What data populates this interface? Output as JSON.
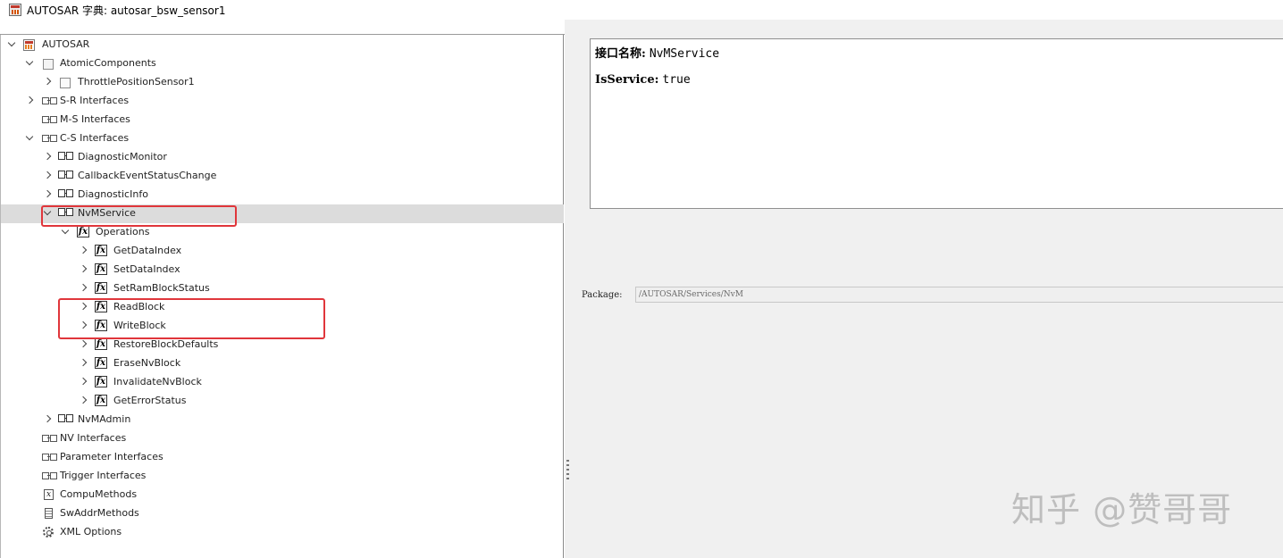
{
  "window": {
    "title": "AUTOSAR 字典: autosar_bsw_sensor1"
  },
  "tree": {
    "root": "AUTOSAR",
    "atomic_components": "AtomicComponents",
    "throttle_sensor": "ThrottlePositionSensor1",
    "sr_interfaces": "S-R Interfaces",
    "ms_interfaces": "M-S Interfaces",
    "cs_interfaces": "C-S Interfaces",
    "cs_items": [
      "DiagnosticMonitor",
      "CallbackEventStatusChange",
      "DiagnosticInfo",
      "NvMService"
    ],
    "operations_label": "Operations",
    "operations": [
      "GetDataIndex",
      "SetDataIndex",
      "SetRamBlockStatus",
      "ReadBlock",
      "WriteBlock",
      "RestoreBlockDefaults",
      "EraseNvBlock",
      "InvalidateNvBlock",
      "GetErrorStatus"
    ],
    "nvm_admin": "NvMAdmin",
    "nv_interfaces": "NV Interfaces",
    "parameter_interfaces": "Parameter Interfaces",
    "trigger_interfaces": "Trigger Interfaces",
    "compu_methods": "CompuMethods",
    "sw_addr_methods": "SwAddrMethods",
    "xml_options": "XML Options",
    "selected": "NvMService"
  },
  "details": {
    "name_label": "接口名称:",
    "name_value": "NvMService",
    "is_service_label": "IsService:",
    "is_service_value": "true",
    "package_label": "Package:",
    "package_value": "/AUTOSAR/Services/NvM"
  },
  "watermark": "知乎 @赞哥哥",
  "colors": {
    "highlight": "#e0363b",
    "selected_row": "#dcdcdc",
    "pane_bg": "#f0f0f0"
  }
}
